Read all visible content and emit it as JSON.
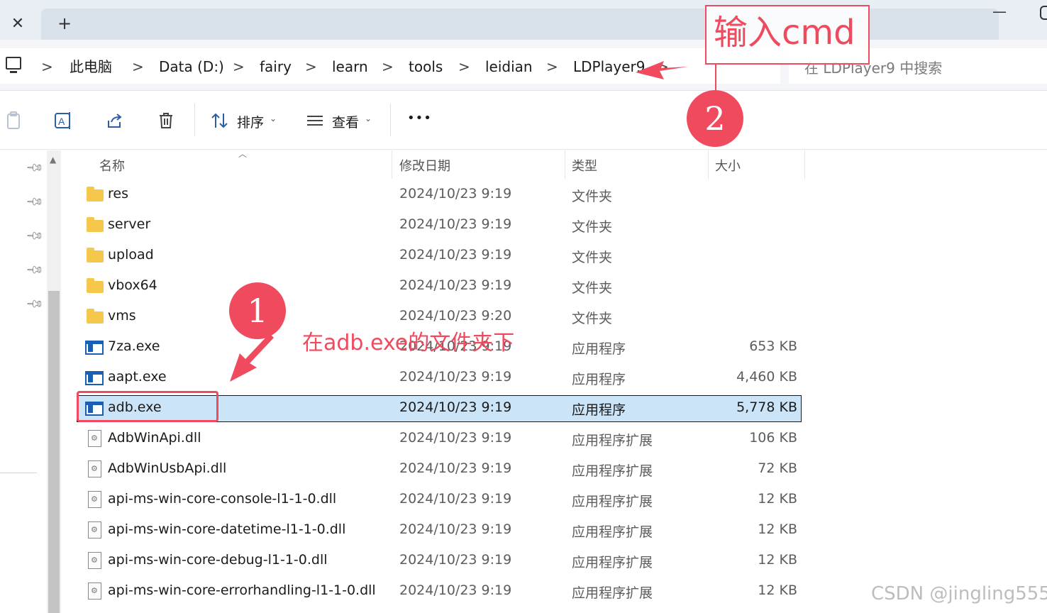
{
  "tabbar": {
    "close_glyph": "✕",
    "new_tab_glyph": "+",
    "minimize_glyph": "—"
  },
  "address": {
    "breadcrumbs": [
      "此电脑",
      "Data (D:)",
      "fairy",
      "learn",
      "tools",
      "leidian",
      "LDPlayer9"
    ],
    "separator": ">",
    "search_placeholder": "在 LDPlayer9 中搜索"
  },
  "toolbar": {
    "icons": [
      "paste-icon",
      "rename-icon",
      "share-icon",
      "delete-icon"
    ],
    "sort_label": "排序",
    "view_label": "查看",
    "more_label": "•••"
  },
  "columns": {
    "name": "名称",
    "date": "修改日期",
    "type": "类型",
    "size": "大小"
  },
  "files": [
    {
      "name": "res",
      "date": "2024/10/23 9:19",
      "type": "文件夹",
      "size": "",
      "kind": "folder"
    },
    {
      "name": "server",
      "date": "2024/10/23 9:19",
      "type": "文件夹",
      "size": "",
      "kind": "folder"
    },
    {
      "name": "upload",
      "date": "2024/10/23 9:19",
      "type": "文件夹",
      "size": "",
      "kind": "folder"
    },
    {
      "name": "vbox64",
      "date": "2024/10/23 9:19",
      "type": "文件夹",
      "size": "",
      "kind": "folder"
    },
    {
      "name": "vms",
      "date": "2024/10/23 9:20",
      "type": "文件夹",
      "size": "",
      "kind": "folder"
    },
    {
      "name": "7za.exe",
      "date": "2024/10/23 9:19",
      "type": "应用程序",
      "size": "653 KB",
      "kind": "exe"
    },
    {
      "name": "aapt.exe",
      "date": "2024/10/23 9:19",
      "type": "应用程序",
      "size": "4,460 KB",
      "kind": "exe"
    },
    {
      "name": "adb.exe",
      "date": "2024/10/23 9:19",
      "type": "应用程序",
      "size": "5,778 KB",
      "kind": "exe",
      "selected": true
    },
    {
      "name": "AdbWinApi.dll",
      "date": "2024/10/23 9:19",
      "type": "应用程序扩展",
      "size": "106 KB",
      "kind": "dll"
    },
    {
      "name": "AdbWinUsbApi.dll",
      "date": "2024/10/23 9:19",
      "type": "应用程序扩展",
      "size": "72 KB",
      "kind": "dll"
    },
    {
      "name": "api-ms-win-core-console-l1-1-0.dll",
      "date": "2024/10/23 9:19",
      "type": "应用程序扩展",
      "size": "12 KB",
      "kind": "dll"
    },
    {
      "name": "api-ms-win-core-datetime-l1-1-0.dll",
      "date": "2024/10/23 9:19",
      "type": "应用程序扩展",
      "size": "12 KB",
      "kind": "dll"
    },
    {
      "name": "api-ms-win-core-debug-l1-1-0.dll",
      "date": "2024/10/23 9:19",
      "type": "应用程序扩展",
      "size": "12 KB",
      "kind": "dll"
    },
    {
      "name": "api-ms-win-core-errorhandling-l1-1-0.dll",
      "date": "2024/10/23 9:19",
      "type": "应用程序扩展",
      "size": "12 KB",
      "kind": "dll"
    }
  ],
  "annotations": {
    "cmd_text": "输入cmd",
    "badge_1": "1",
    "badge_2": "2",
    "note": "在adb.exe的文件夹下",
    "color": "#f04a5e"
  },
  "watermark": "CSDN @jingling555"
}
